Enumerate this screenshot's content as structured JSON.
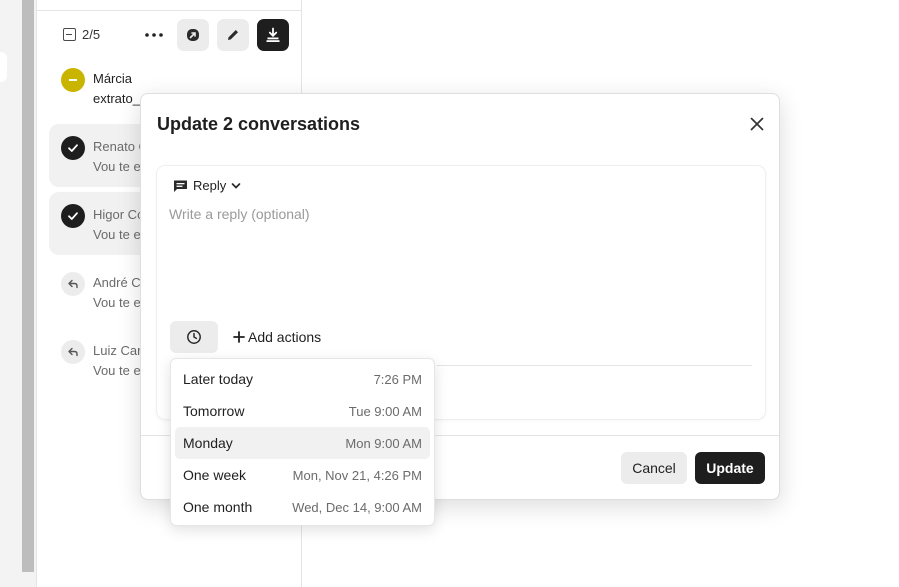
{
  "toolbar": {
    "selected_count": "2/5",
    "more_glyph": "•••"
  },
  "conversations": [
    {
      "name": "Márcia",
      "preview": "extrato_",
      "status": "snoozed",
      "selected": false,
      "unread": true
    },
    {
      "name": "Renato C",
      "preview": "Vou te e",
      "status": "checked",
      "selected": true,
      "unread": false
    },
    {
      "name": "Higor Co",
      "preview": "Vou te e",
      "status": "checked",
      "selected": true,
      "unread": false
    },
    {
      "name": "André C",
      "preview": "Vou te e",
      "status": "replied",
      "selected": false,
      "unread": false
    },
    {
      "name": "Luiz Carl",
      "preview": "Vou te e",
      "status": "replied",
      "selected": false,
      "unread": false
    }
  ],
  "modal": {
    "title": "Update 2 conversations",
    "reply_type": "Reply",
    "reply_placeholder": "Write a reply (optional)",
    "add_actions": "Add actions",
    "cancel_label": "Cancel",
    "update_label": "Update"
  },
  "snooze_menu": [
    {
      "label": "Later today",
      "time": "7:26 PM"
    },
    {
      "label": "Tomorrow",
      "time": "Tue 9:00 AM"
    },
    {
      "label": "Monday",
      "time": "Mon 9:00 AM"
    },
    {
      "label": "One week",
      "time": "Mon, Nov 21, 4:26 PM"
    },
    {
      "label": "One month",
      "time": "Wed, Dec 14, 9:00 AM"
    }
  ],
  "colors": {
    "snoozed_avatar": "#c9b400",
    "checked_avatar": "#1e1e1e",
    "replied_avatar": "#ececec",
    "primary_button": "#1e1e1e"
  }
}
